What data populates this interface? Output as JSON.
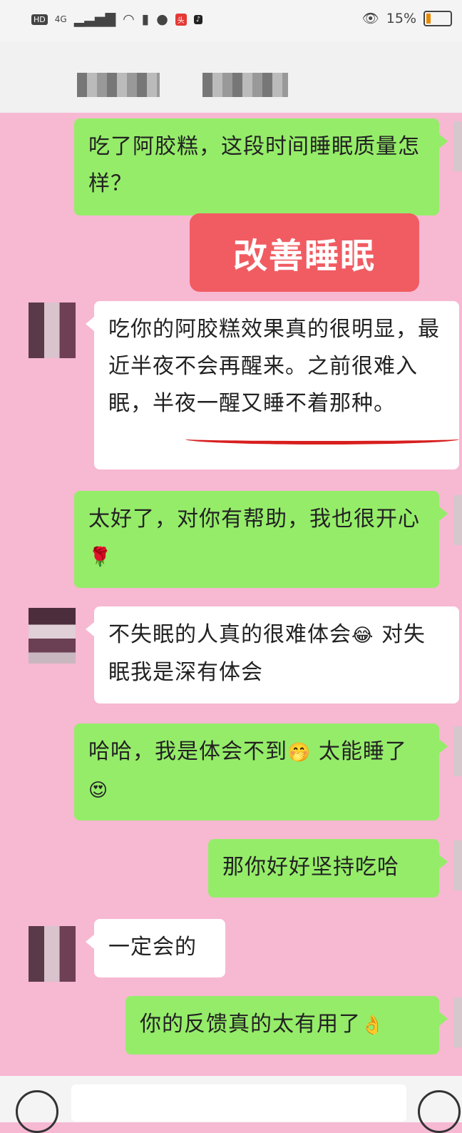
{
  "status": {
    "hd": "HD",
    "net": "4G",
    "battery": "15%"
  },
  "tag": "改善睡眠",
  "messages": [
    {
      "text": "吃了阿胶糕，这段时间睡眠质量怎样？"
    },
    {
      "text": "吃你的阿胶糕效果真的很明显，最近半夜不会再醒来。之前很难入眠，半夜一醒又睡不着那种。"
    },
    {
      "text": "太好了，对你有帮助，我也很开心",
      "emoji": "🌹"
    },
    {
      "text_a": "不失眠的人真的很难体会",
      "emoji": "😂",
      "text_b": "对失眠我是深有体会"
    },
    {
      "text_a": "哈哈，我是体会不到",
      "emoji_a": "🤭",
      "text_b": "太能睡了",
      "emoji_b": "😍"
    },
    {
      "text": "那你好好坚持吃哈"
    },
    {
      "text": "一定会的"
    },
    {
      "text": "你的反馈真的太有用了",
      "emoji": "👌"
    }
  ]
}
